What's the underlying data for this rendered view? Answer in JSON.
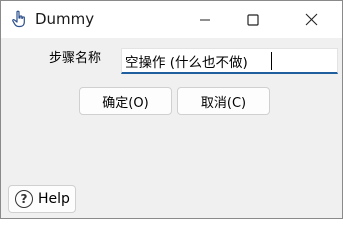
{
  "window": {
    "title": "Dummy",
    "icons": {
      "app": "hand-pointer-icon",
      "minimize": "minimize-icon",
      "maximize": "maximize-icon",
      "close": "close-icon"
    }
  },
  "form": {
    "step_name_label": "步骤名称",
    "step_name_value": "空操作 (什么也不做)"
  },
  "buttons": {
    "ok_label": "确定(O)",
    "cancel_label": "取消(C)",
    "help_label": "Help"
  },
  "colors": {
    "input_focus_underline": "#1f5f9f",
    "window_background": "#f0f0f0",
    "titlebar_background": "#ffffff"
  }
}
